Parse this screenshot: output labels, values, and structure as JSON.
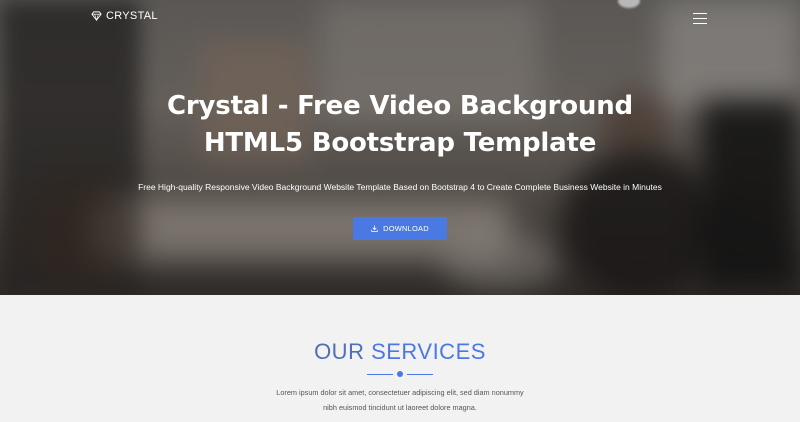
{
  "nav": {
    "brand": "CRYSTAL",
    "brand_icon": "diamond-icon",
    "menu_icon": "hamburger-menu-icon"
  },
  "hero": {
    "title": "Crystal - Free Video Background\nHTML5 Bootstrap Template",
    "subtitle": "Free High-quality Responsive Video Background Website Template Based on Bootstrap 4 to Create Complete Business Website in Minutes",
    "button_label": "DOWNLOAD",
    "button_icon": "download-icon"
  },
  "services": {
    "title_part1": "OUR ",
    "title_part2": "SERVICES",
    "text_line1": "Lorem ipsum dolor sit amet, consectetuer adipiscing elit, sed diam nonummy",
    "text_line2": "nibh euismod tincidunt ut laoreet dolore magna."
  },
  "colors": {
    "accent": "#4b79e4",
    "title_dark_blue": "#4f6fb8",
    "section_bg": "#f2f2f2"
  }
}
